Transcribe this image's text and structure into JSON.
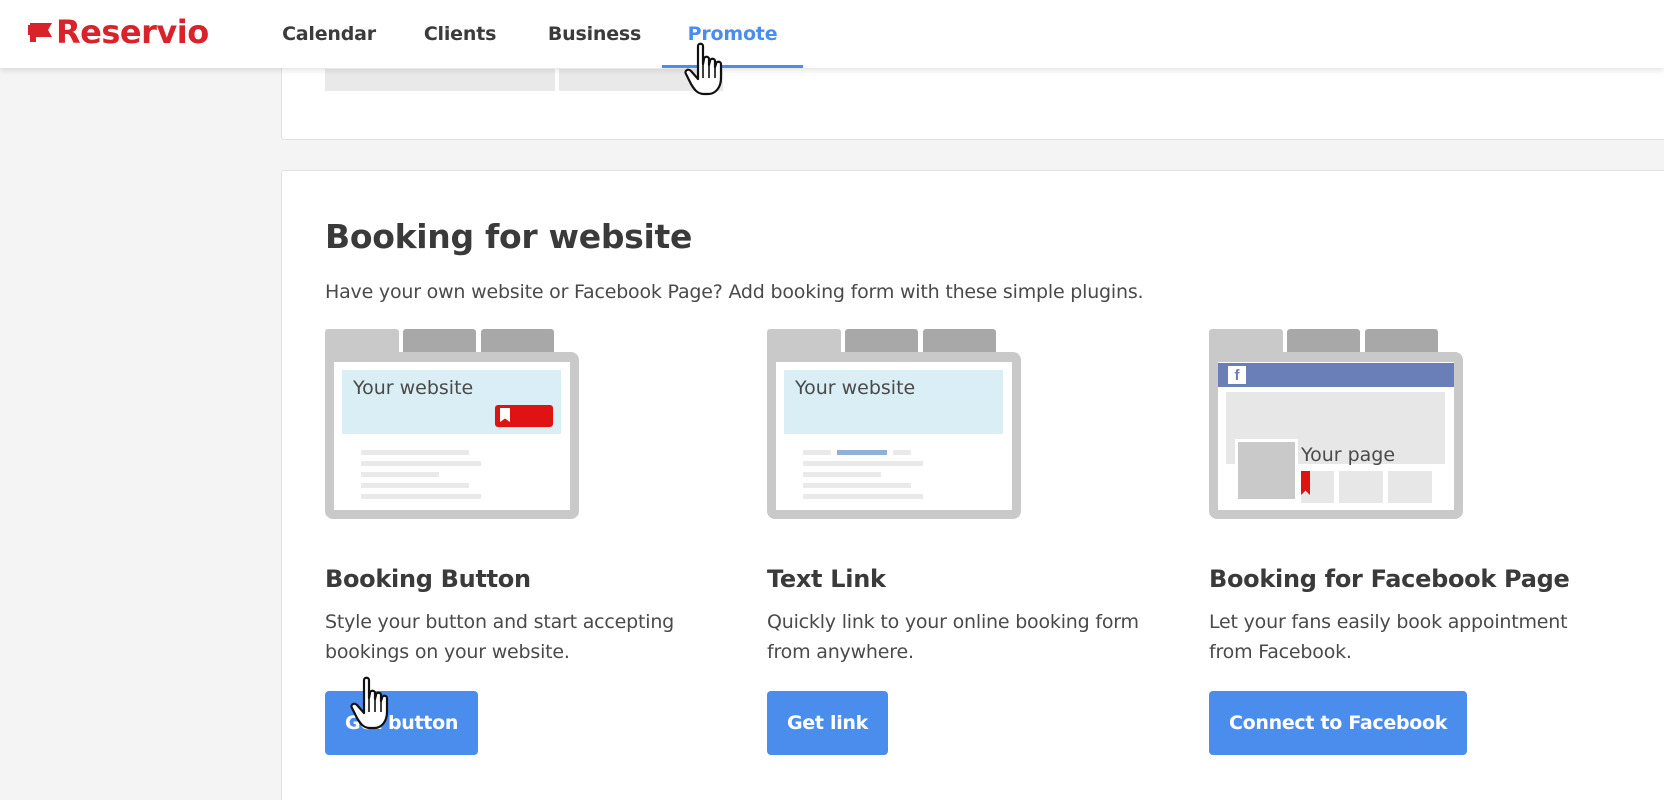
{
  "app": {
    "logo_text": "Reservio",
    "brand_color": "#d8232a",
    "accent_color": "#4b8ded"
  },
  "nav": {
    "items": [
      {
        "label": "Calendar",
        "active": false
      },
      {
        "label": "Clients",
        "active": false
      },
      {
        "label": "Business",
        "active": false
      },
      {
        "label": "Promote",
        "active": true
      }
    ]
  },
  "section": {
    "title": "Booking for website",
    "description": "Have your own website or Facebook Page? Add booking form with these simple plugins."
  },
  "plugins": [
    {
      "illustration_text": "Your website",
      "title": "Booking Button",
      "description": "Style your button and start accepting bookings on your website.",
      "button_label": "Get button"
    },
    {
      "illustration_text": "Your website",
      "title": "Text Link",
      "description": "Quickly link to your online booking form from anywhere.",
      "button_label": "Get link"
    },
    {
      "illustration_text": "Your page",
      "illustration_icon": "facebook-icon",
      "title": "Booking for Facebook Page",
      "description": "Let your fans easily book appointment from Facebook.",
      "button_label": "Connect to Facebook"
    }
  ]
}
